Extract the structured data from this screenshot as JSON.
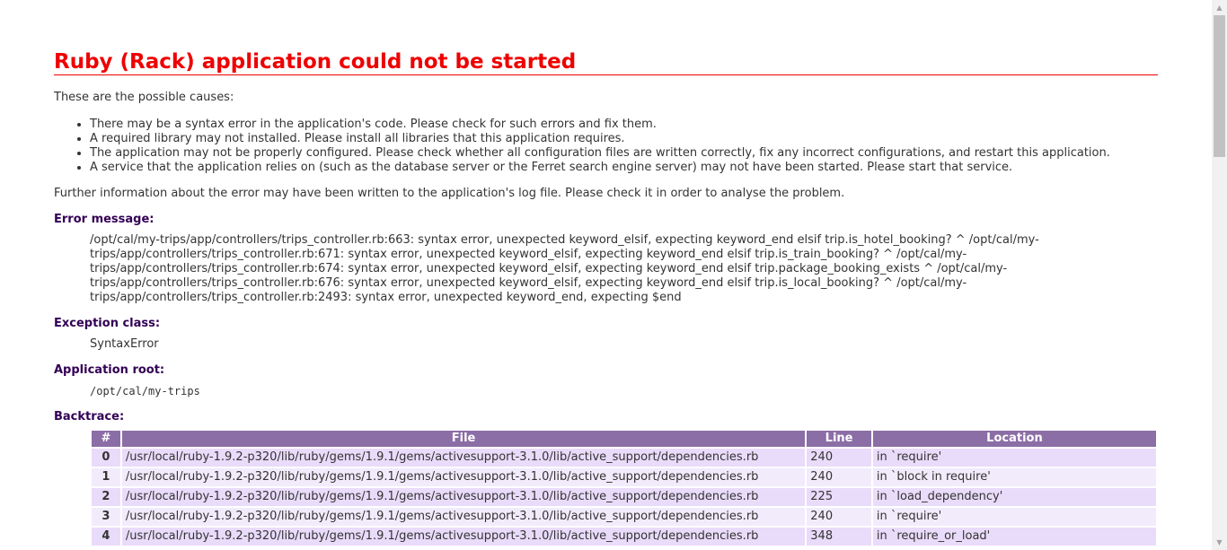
{
  "title": "Ruby (Rack) application could not be started",
  "intro": "These are the possible causes:",
  "causes": [
    "There may be a syntax error in the application's code. Please check for such errors and fix them.",
    "A required library may not installed. Please install all libraries that this application requires.",
    "The application may not be properly configured. Please check whether all configuration files are written correctly, fix any incorrect configurations, and restart this application.",
    "A service that the application relies on (such as the database server or the Ferret search engine server) may not have been started. Please start that service."
  ],
  "further": "Further information about the error may have been written to the application's log file. Please check it in order to analyse the problem.",
  "error_message": {
    "label": "Error message:",
    "lines": [
      "/opt/cal/my-trips/app/controllers/trips_controller.rb:663: syntax error, unexpected keyword_elsif, expecting keyword_end elsif trip.is_hotel_booking? ^ /opt/cal/my-",
      "trips/app/controllers/trips_controller.rb:671: syntax error, unexpected keyword_elsif, expecting keyword_end elsif trip.is_train_booking? ^ /opt/cal/my-",
      "trips/app/controllers/trips_controller.rb:674: syntax error, unexpected keyword_elsif, expecting keyword_end elsif trip.package_booking_exists ^ /opt/cal/my-",
      "trips/app/controllers/trips_controller.rb:676: syntax error, unexpected keyword_elsif, expecting keyword_end elsif trip.is_local_booking? ^ /opt/cal/my-",
      "trips/app/controllers/trips_controller.rb:2493: syntax error, unexpected keyword_end, expecting $end"
    ]
  },
  "exception_class": {
    "label": "Exception class:",
    "value": "SyntaxError"
  },
  "application_root": {
    "label": "Application root:",
    "value": "/opt/cal/my-trips"
  },
  "backtrace": {
    "label": "Backtrace:",
    "headers": [
      "#",
      "File",
      "Line",
      "Location"
    ],
    "rows": [
      [
        "0",
        "/usr/local/ruby-1.9.2-p320/lib/ruby/gems/1.9.1/gems/activesupport-3.1.0/lib/active_support/dependencies.rb",
        "240",
        "in `require'"
      ],
      [
        "1",
        "/usr/local/ruby-1.9.2-p320/lib/ruby/gems/1.9.1/gems/activesupport-3.1.0/lib/active_support/dependencies.rb",
        "240",
        "in `block in require'"
      ],
      [
        "2",
        "/usr/local/ruby-1.9.2-p320/lib/ruby/gems/1.9.1/gems/activesupport-3.1.0/lib/active_support/dependencies.rb",
        "225",
        "in `load_dependency'"
      ],
      [
        "3",
        "/usr/local/ruby-1.9.2-p320/lib/ruby/gems/1.9.1/gems/activesupport-3.1.0/lib/active_support/dependencies.rb",
        "240",
        "in `require'"
      ],
      [
        "4",
        "/usr/local/ruby-1.9.2-p320/lib/ruby/gems/1.9.1/gems/activesupport-3.1.0/lib/active_support/dependencies.rb",
        "348",
        "in `require_or_load'"
      ]
    ]
  },
  "colors": {
    "title": "#ee0000",
    "heading": "#330055",
    "table_header": "#8b6ea6",
    "row_even": "#e9dbfa",
    "row_odd": "#f2ebfc"
  },
  "scrollbar": {
    "up_icon": "triangle-up-icon",
    "down_icon": "triangle-down-icon"
  }
}
